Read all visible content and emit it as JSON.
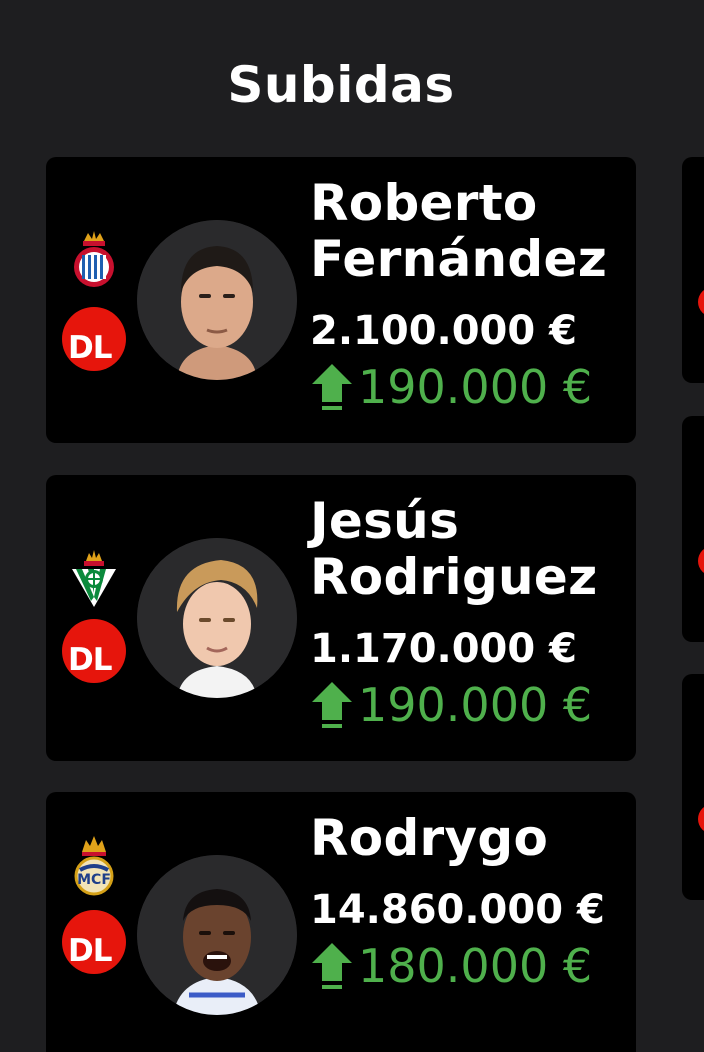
{
  "section": {
    "title": "Subidas"
  },
  "colors": {
    "background": "#1e1e20",
    "card": "#000000",
    "badge": "#e6150c",
    "increase": "#4fb04c"
  },
  "players": [
    {
      "name_line1": "Roberto",
      "name_line2": "Fernández",
      "value": "2.100.000 €",
      "change": "190.000 €",
      "position": "DL",
      "club_icon": "espanyol-crest-icon",
      "trend_icon": "arrow-up-icon"
    },
    {
      "name_line1": "Jesús",
      "name_line2": "Rodriguez",
      "value": "1.170.000 €",
      "change": "190.000 €",
      "position": "DL",
      "club_icon": "real-betis-crest-icon",
      "trend_icon": "arrow-up-icon"
    },
    {
      "name_line1": "Rodrygo",
      "name_line2": "",
      "value": "14.860.000 €",
      "change": "180.000 €",
      "position": "DL",
      "club_icon": "real-madrid-crest-icon",
      "trend_icon": "arrow-up-icon"
    }
  ]
}
